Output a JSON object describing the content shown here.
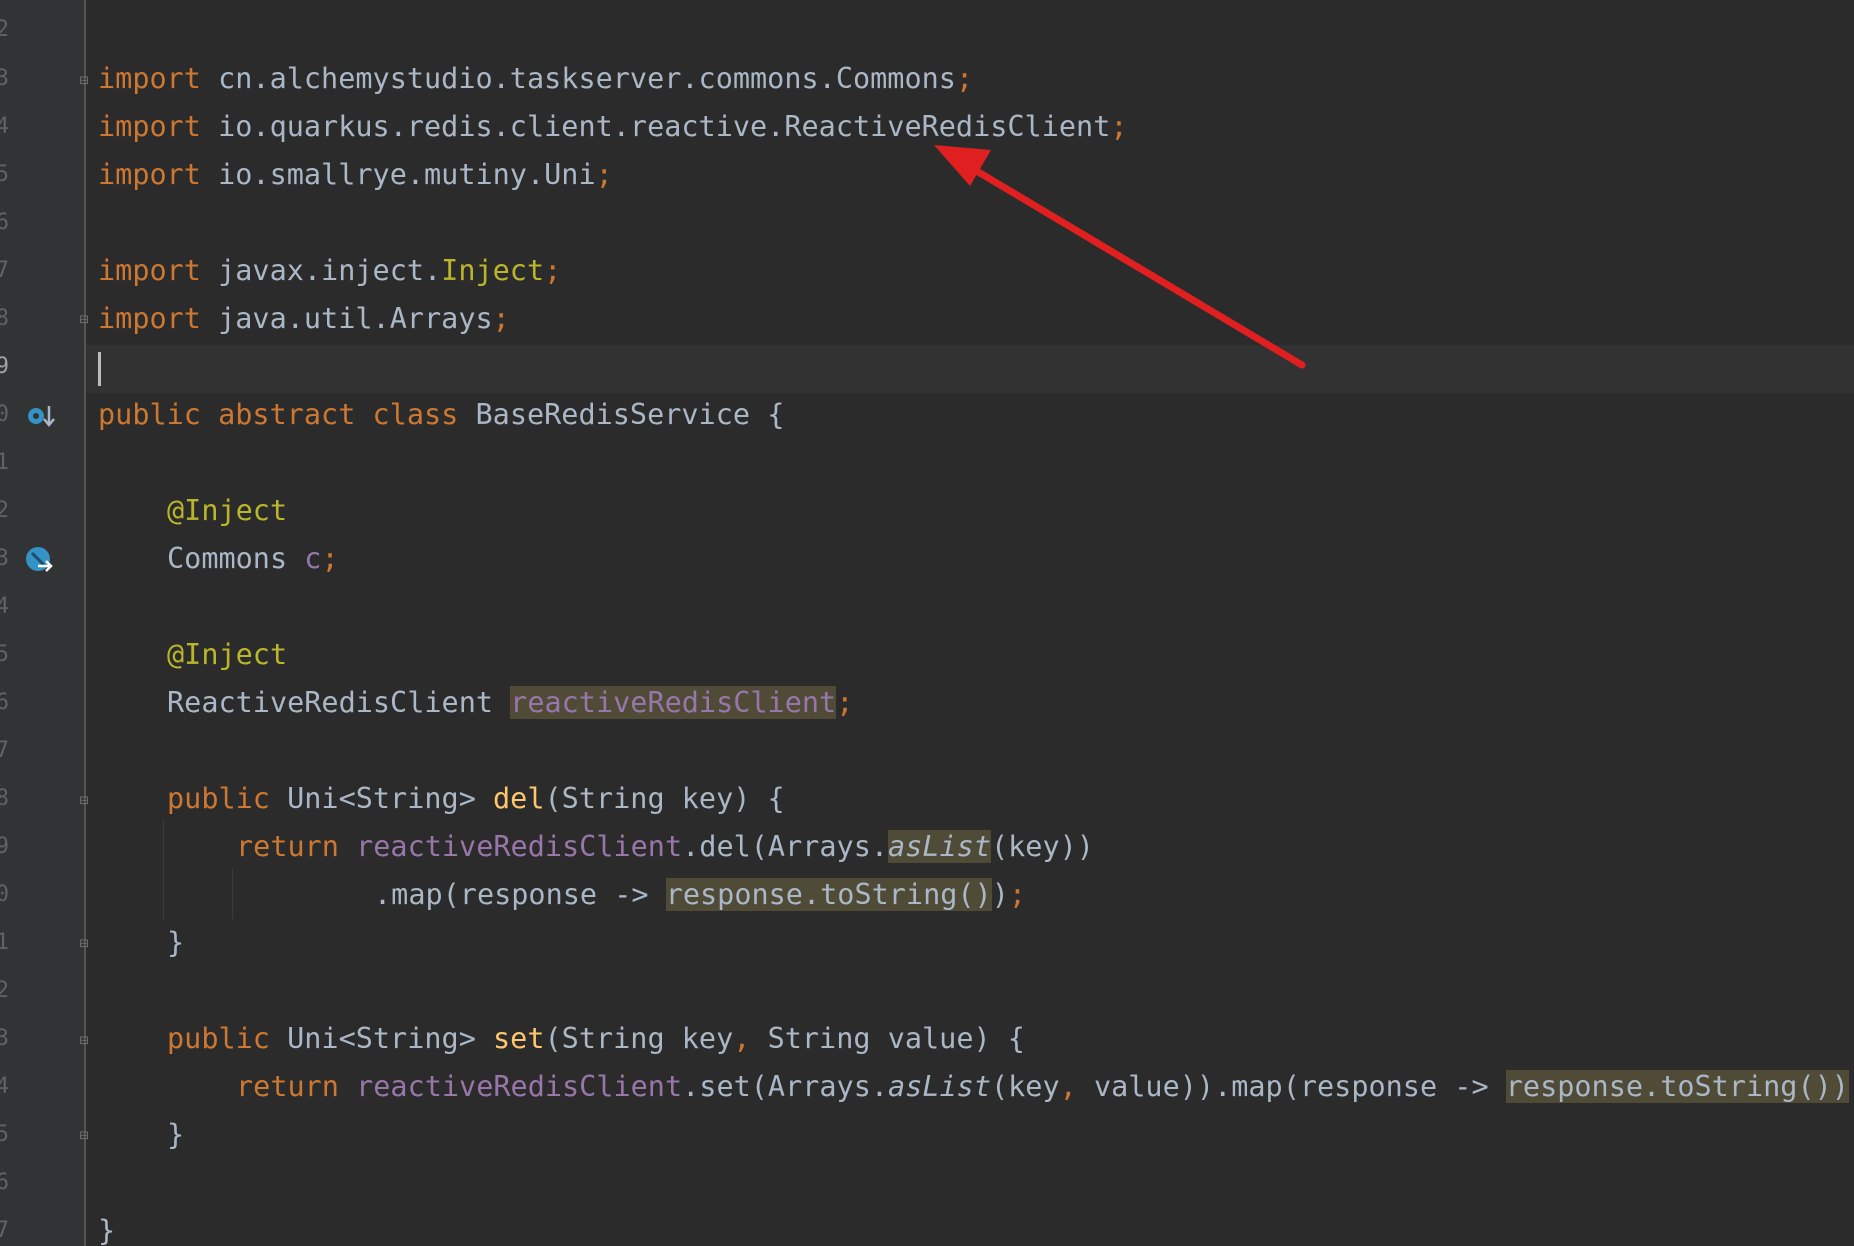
{
  "editor": {
    "line_numbers": [
      "2",
      "3",
      "4",
      "5",
      "6",
      "7",
      "8",
      "9",
      "0",
      "1",
      "2",
      "3",
      "4",
      "5",
      "6",
      "7",
      "8",
      "9",
      "0",
      "1",
      "2",
      "3",
      "4",
      "5",
      "6",
      "7"
    ],
    "current_line_number": "9",
    "fold_markers": [
      "⊟",
      "⊟",
      "⊟",
      "⊟",
      "⊟",
      "⊟"
    ],
    "colors": {
      "background": "#2b2b2b",
      "keyword": "#cc7832",
      "annotation": "#bbb529",
      "field": "#9876aa",
      "method": "#ffc66d",
      "text": "#a9b7c6",
      "arrow": "#e02020"
    },
    "code": {
      "l3": {
        "kw": "import",
        "pkg": " cn.alchemystudio.taskserver.commons.Commons",
        "semi": ";"
      },
      "l4": {
        "kw": "import",
        "pkg": " io.quarkus.redis.client.reactive.ReactiveRedisClient",
        "semi": ";"
      },
      "l5": {
        "kw": "import",
        "pkg": " io.smallrye.mutiny.Uni",
        "semi": ";"
      },
      "l7": {
        "kw": "import",
        "pkg": " javax.inject.",
        "ann": "Inject",
        "semi": ";"
      },
      "l8": {
        "kw": "import",
        "pkg": " java.util.Arrays",
        "semi": ";"
      },
      "l10": {
        "kw1": "public",
        "kw2": " abstract",
        "kw3": " class",
        "rest": " BaseRedisService {"
      },
      "l12": {
        "ann": "@Inject"
      },
      "l13": {
        "type": "Commons ",
        "fld": "c",
        "semi": ";"
      },
      "l15": {
        "ann": "@Inject"
      },
      "l16": {
        "type": "ReactiveRedisClient ",
        "fld": "reactiveRedisClient",
        "semi": ";"
      },
      "l18": {
        "kw": "public",
        "t1": " Uni<String> ",
        "fn": "del",
        "t2": "(String key) {"
      },
      "l19": {
        "kw": "return ",
        "fld": "reactiveRedisClient",
        "t1": ".del(Arrays.",
        "it": "asList",
        "t2": "(key))"
      },
      "l20": {
        "t1": ".map(response -> ",
        "hl": "response.toString()",
        "t2": ")",
        "semi": ";"
      },
      "l21": {
        "t": "}"
      },
      "l23": {
        "kw": "public",
        "t1": " Uni<String> ",
        "fn": "set",
        "t2": "(String key",
        "comma": ",",
        "t3": " String value) {"
      },
      "l24": {
        "kw": "return ",
        "fld": "reactiveRedisClient",
        "t1": ".set(Arrays.",
        "it": "asList",
        "t2": "(key",
        "comma": ",",
        "t3": " value)).map(response -> ",
        "hl": "response.toString())"
      },
      "l25": {
        "t": "}"
      },
      "l27": {
        "t": "}"
      }
    }
  }
}
